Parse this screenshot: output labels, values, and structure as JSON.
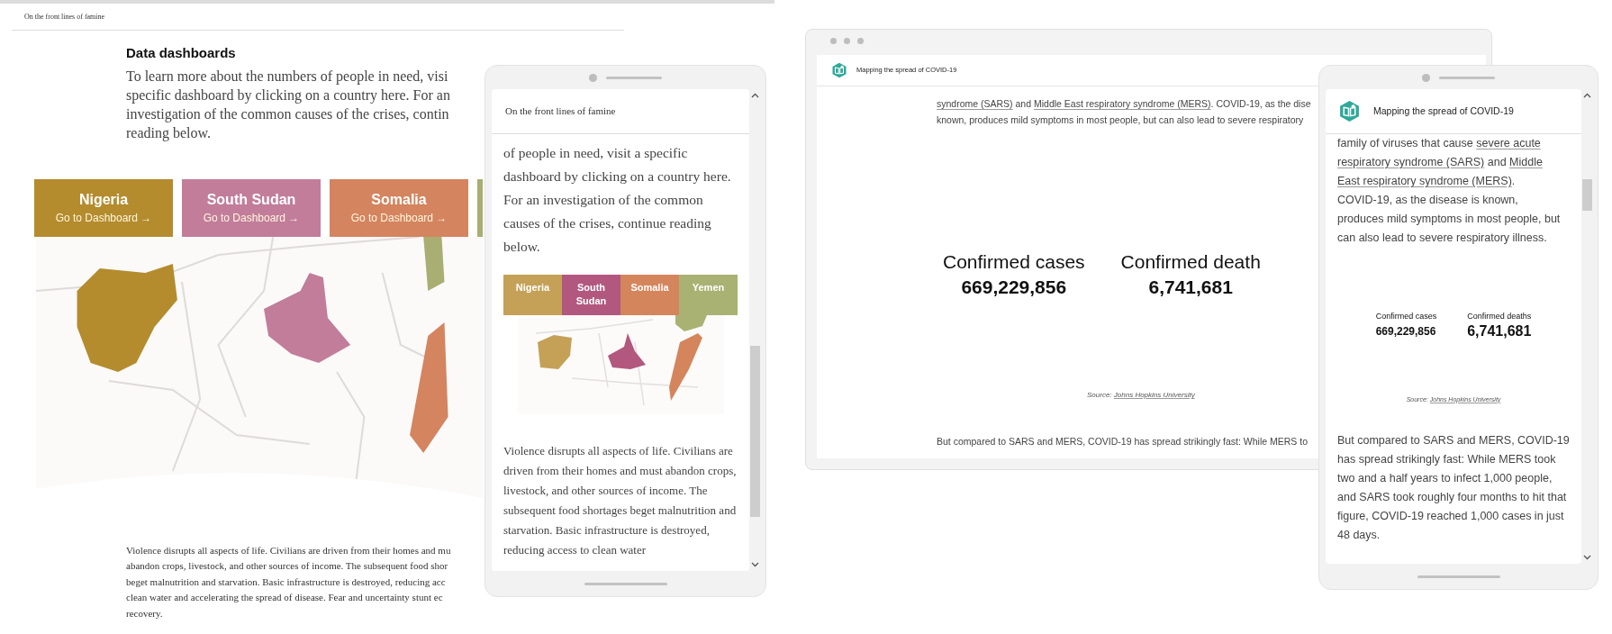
{
  "left_page": {
    "header_title": "On the front lines of famine",
    "heading": "Data dashboards",
    "intro_lines": [
      "To learn more about the numbers of people in need, visi",
      "specific dashboard by clicking on a country here. For an",
      "investigation of the common causes of the crises, contin",
      "reading below."
    ],
    "dashboard_buttons": [
      {
        "title": "Nigeria",
        "action": "Go to Dashboard →",
        "color": "#b48c2e"
      },
      {
        "title": "South Sudan",
        "action": "Go to Dashboard →",
        "color": "#c27d9b"
      },
      {
        "title": "Somalia",
        "action": "Go to Dashboard →",
        "color": "#d4845f"
      },
      {
        "color": "#a9ae72"
      }
    ],
    "map": {
      "kind": "picture"
    },
    "body_lines": [
      "Violence disrupts all aspects of life. Civilians are driven from their homes and mu",
      "abandon crops, livestock, and other sources of income. The subsequent food shor",
      "beget malnutrition and starvation. Basic infrastructure is destroyed, reducing acc",
      "clean water and accelerating the spread of disease. Fear and uncertainty stunt ec",
      "recovery."
    ]
  },
  "phone_famine": {
    "header_title": "On the front lines of famine",
    "intro": "of people in need, visit a specific dashboard by clicking on a country here. For an investigation of the common causes of the crises, continue reading below.",
    "country_tabs": [
      {
        "label": "Nigeria",
        "color": "#c4a157"
      },
      {
        "label": "South Sudan",
        "color": "#b2587f"
      },
      {
        "label": "Somalia",
        "color": "#d5855c"
      },
      {
        "label": "Yemen",
        "color": "#a9b273"
      }
    ],
    "map": {
      "kind": "picture"
    },
    "body": "Violence disrupts all aspects of life. Civilians are driven from their homes and must abandon crops, livestock, and other sources of income. The subsequent food shortages beget malnutrition and starvation. Basic infrastructure is destroyed, reducing access to clean water"
  },
  "desktop_covid": {
    "header_title": "Mapping the spread of COVID-19",
    "intro_lines": [
      [
        {
          "text": "syndrome (SARS)",
          "link": true
        },
        {
          "text": " and ",
          "link": false
        },
        {
          "text": "Middle East respiratory syndrome (MERS)",
          "link": true
        },
        {
          "text": ". COVID-19, as the dise",
          "link": false
        }
      ],
      [
        {
          "text": "known, produces mild symptoms in most people, but can also lead to severe respiratory",
          "link": false
        }
      ]
    ],
    "stats": [
      {
        "label": "Confirmed cases",
        "value": "669,229,856"
      },
      {
        "label": "Confirmed death",
        "value": "6,741,681"
      }
    ],
    "source": {
      "prefix": "Source:",
      "link": "Johns Hopkins University"
    },
    "body_line": "But compared to SARS and MERS, COVID-19 has spread strikingly fast: While MERS to"
  },
  "phone_covid": {
    "header_title": "Mapping the spread of COVID-19",
    "intro_lines": [
      [
        {
          "text": "family of viruses that cause ",
          "link": false
        },
        {
          "text": "severe acute",
          "link": true
        }
      ],
      [
        {
          "text": "respiratory syndrome (SARS)",
          "link": true
        },
        {
          "text": " and ",
          "link": false
        },
        {
          "text": "Middle",
          "link": true
        }
      ],
      [
        {
          "text": "East respiratory syndrome (MERS)",
          "link": true
        },
        {
          "text": ".",
          "link": false
        }
      ],
      [
        {
          "text": "COVID-19, as the disease is known,",
          "link": false
        }
      ],
      [
        {
          "text": "produces mild symptoms in most people, but",
          "link": false
        }
      ],
      [
        {
          "text": "can also lead to severe respiratory illness.",
          "link": false
        }
      ]
    ],
    "stats": [
      {
        "label": "Confirmed cases",
        "value": "669,229,856"
      },
      {
        "label": "Confirmed deaths",
        "value": "6,741,681"
      }
    ],
    "source": {
      "prefix": "Source:",
      "link": "Johns Hopkins University"
    },
    "body": "But compared to SARS and MERS, COVID-19 has spread strikingly fast: While MERS took two and a half years to infect 1,000 people, and SARS took roughly four months to hit that figure, COVID-19 reached 1,000 cases in just 48 days."
  }
}
